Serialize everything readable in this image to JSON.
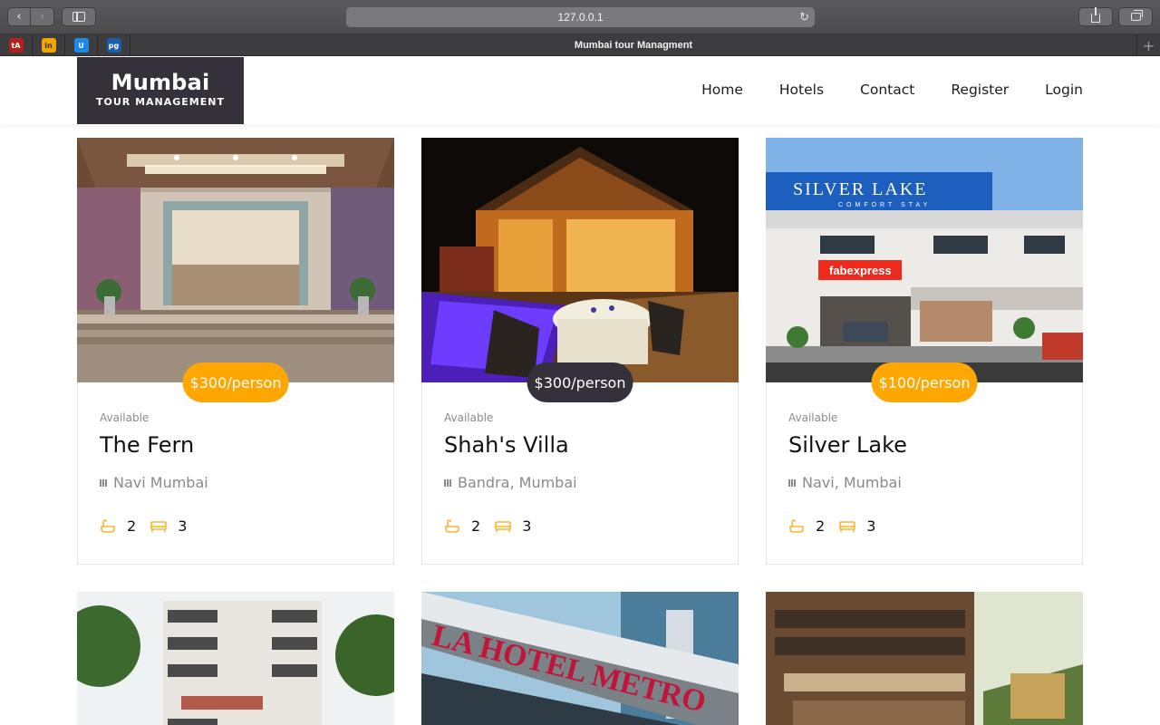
{
  "browser": {
    "url": "127.0.0.1",
    "tab_title": "Mumbai tour Managment",
    "favicons": [
      {
        "label": "tA",
        "bg": "#b1221c",
        "fg": "#ffffff"
      },
      {
        "label": "in",
        "bg": "#f0a500",
        "fg": "#333333"
      },
      {
        "label": "U",
        "bg": "#1e88e5",
        "fg": "#ffffff"
      },
      {
        "label": "pg",
        "bg": "#1b5ea8",
        "fg": "#ffffff"
      }
    ]
  },
  "header": {
    "logo_title": "Mumbai",
    "logo_subtitle": "TOUR MANAGEMENT",
    "nav": [
      "Home",
      "Hotels",
      "Contact",
      "Register",
      "Login"
    ]
  },
  "colors": {
    "accent": "#fea601",
    "dark": "#34313b"
  },
  "hotels": [
    {
      "name": "The Fern",
      "status": "Available",
      "location": "Navi Mumbai",
      "price": "$300/person",
      "baths": "2",
      "beds": "3",
      "badge_color": "#fea601"
    },
    {
      "name": "Shah's Villa",
      "status": "Available",
      "location": "Bandra, Mumbai",
      "price": "$300/person",
      "baths": "2",
      "beds": "3",
      "badge_color": "#34313b"
    },
    {
      "name": "Silver Lake",
      "status": "Available",
      "location": "Navi, Mumbai",
      "price": "$100/person",
      "baths": "2",
      "beds": "3",
      "badge_color": "#fea601"
    }
  ],
  "photo_text": {
    "silver_lake_sign": "SILVER LAKE",
    "silver_lake_sub": "COMFORT STAY",
    "fabexpress": "fabexpress",
    "hotel_metro": "LA HOTEL METRO"
  }
}
